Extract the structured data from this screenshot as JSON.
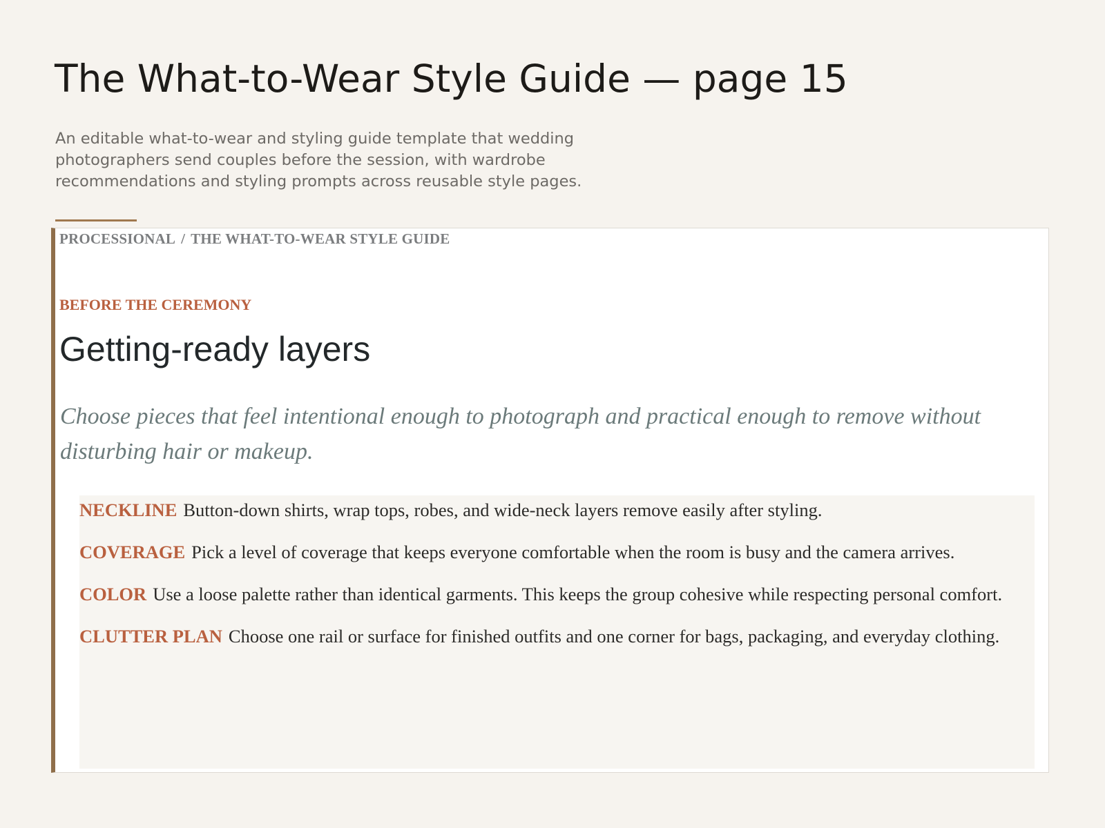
{
  "header": {
    "title": "The What-to-Wear Style Guide — page 15",
    "description": "An editable what-to-wear and styling guide template that wedding photographers send couples before the session, with wardrobe recommendations and styling prompts across reusable style pages."
  },
  "card": {
    "breadcrumb": [
      "PROCESSIONAL",
      "THE WHAT-TO-WEAR STYLE GUIDE"
    ],
    "breadcrumb_separator": "/",
    "eyebrow": "BEFORE THE CEREMONY",
    "title": "Getting-ready layers",
    "lede": "Choose pieces that feel intentional enough to photograph and practical enough to remove without disturbing hair or makeup.",
    "notes": [
      {
        "label": "NECKLINE",
        "text": "Button-down shirts, wrap tops, robes, and wide-neck layers remove easily after styling."
      },
      {
        "label": "COVERAGE",
        "text": "Pick a level of coverage that keeps everyone comfortable when the room is busy and the camera arrives."
      },
      {
        "label": "COLOR",
        "text": "Use a loose palette rather than identical garments. This keeps the group cohesive while respecting personal comfort."
      },
      {
        "label": "CLUTTER PLAN",
        "text": "Choose one rail or surface for finished outfits and one corner for bags, packaging, and everyday clothing."
      }
    ]
  },
  "colors": {
    "background": "#f6f3ee",
    "accent_rule": "#a0784e",
    "card_border_accent": "#8f6e4a",
    "label_terracotta": "#b9603f",
    "lede_slate": "#6b7a7a",
    "notes_panel": "#f7f5f1"
  }
}
